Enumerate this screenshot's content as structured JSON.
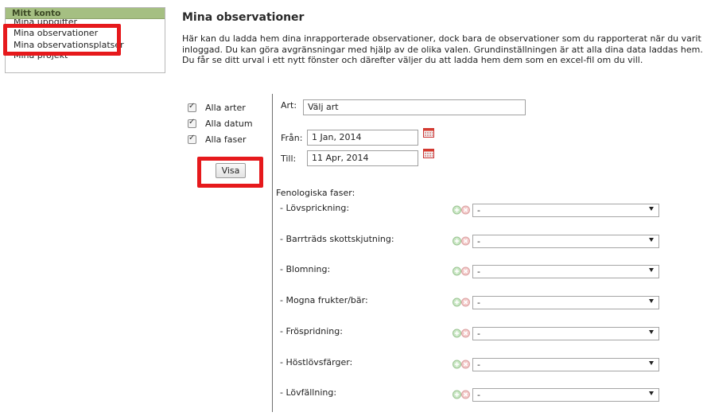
{
  "sidebar": {
    "header": "Mitt konto",
    "items": [
      {
        "label": "Mina uppgifter"
      },
      {
        "label": "Mina observationer"
      },
      {
        "label": "Mina observationsplatser"
      },
      {
        "label": "Mina projekt"
      }
    ]
  },
  "main": {
    "title": "Mina observationer",
    "intro": "Här kan du ladda hem dina inrapporterade observationer, dock bara de observationer som du rapporterat när du varit inloggad. Du kan göra avgränsningar med hjälp av de olika valen. Grundinställningen är att alla dina data laddas hem. Du får se ditt urval i ett nytt fönster och därefter väljer du att ladda hem dem som en excel-fil om du vill."
  },
  "filters": {
    "checkboxes": [
      {
        "label": "Alla arter",
        "checked": true
      },
      {
        "label": "Alla datum",
        "checked": true
      },
      {
        "label": "Alla faser",
        "checked": true
      }
    ],
    "show_button": "Visa"
  },
  "form": {
    "species_label": "Art:",
    "species_value": "Välj art",
    "from_label": "Från:",
    "from_value": "1 Jan, 2014",
    "to_label": "Till:",
    "to_value": "11 Apr, 2014",
    "phases_heading": "Fenologiska faser:",
    "phases": [
      {
        "label": "-  Lövsprickning:",
        "value": "-"
      },
      {
        "label": "-  Barrträds skottskjutning:",
        "value": "-"
      },
      {
        "label": "-  Blomning:",
        "value": "-"
      },
      {
        "label": "-  Mogna frukter/bär:",
        "value": "-"
      },
      {
        "label": "-  Fröspridning:",
        "value": "-"
      },
      {
        "label": "-  Höstlövsfärger:",
        "value": "-"
      },
      {
        "label": "-  Lövfällning:",
        "value": "-"
      }
    ]
  },
  "colors": {
    "highlight": "#e6191c",
    "sidebar_header": "#a5bf82"
  }
}
